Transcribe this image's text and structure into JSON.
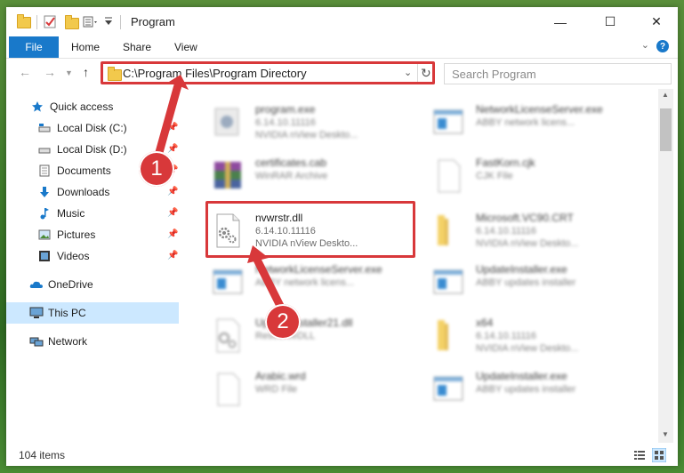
{
  "window": {
    "title": "Program",
    "controls": {
      "minimize": "—",
      "maximize": "☐",
      "close": "✕"
    }
  },
  "ribbon": {
    "file": "File",
    "home": "Home",
    "share": "Share",
    "view": "View",
    "help": "?"
  },
  "address": {
    "path": "C:\\Program Files\\Program Directory",
    "search_placeholder": "Search Program"
  },
  "nav": {
    "items": [
      {
        "label": "Quick access"
      },
      {
        "label": "Local Disk (C:)"
      },
      {
        "label": "Local Disk (D:)"
      },
      {
        "label": "Documents"
      },
      {
        "label": "Downloads"
      },
      {
        "label": "Music"
      },
      {
        "label": "Pictures"
      },
      {
        "label": "Videos"
      },
      {
        "label": "OneDrive"
      },
      {
        "label": "This PC"
      },
      {
        "label": "Network"
      }
    ]
  },
  "files": [
    {
      "name": "program.exe",
      "line1": "6.14.10.11116",
      "line2": "NVIDIA nView Deskto..."
    },
    {
      "name": "NetworkLicenseServer.exe",
      "line1": "ABBY network licens...",
      "line2": ""
    },
    {
      "name": "certificates.cab",
      "line1": "WinRAR Archive",
      "line2": ""
    },
    {
      "name": "FastKorn.cjk",
      "line1": "CJK File",
      "line2": ""
    },
    {
      "name": "nvwrstr.dll",
      "line1": "6.14.10.11116",
      "line2": "NVIDIA nView Deskto..."
    },
    {
      "name": "Microsoft.VC90.CRT",
      "line1": "6.14.10.11116",
      "line2": "NVIDIA nView Deskto..."
    },
    {
      "name": "NetworkLicenseServer.exe",
      "line1": "ABBY network licens...",
      "line2": ""
    },
    {
      "name": "UpdateInstaller.exe",
      "line1": "ABBY updates installer",
      "line2": ""
    },
    {
      "name": "UpdateInstaller21.dll",
      "line1": "ResourceDLL",
      "line2": ""
    },
    {
      "name": "x64",
      "line1": "6.14.10.11116",
      "line2": "NVIDIA nView Deskto..."
    },
    {
      "name": "Arabic.wrd",
      "line1": "WRD File",
      "line2": ""
    },
    {
      "name": "UpdateInstaller.exe",
      "line1": "ABBY updates installer",
      "line2": ""
    }
  ],
  "status": {
    "items": "104 items"
  },
  "markers": {
    "one": "1",
    "two": "2"
  },
  "colors": {
    "accent": "#1979ca",
    "highlight": "#d8383a",
    "selection": "#cce8ff"
  }
}
